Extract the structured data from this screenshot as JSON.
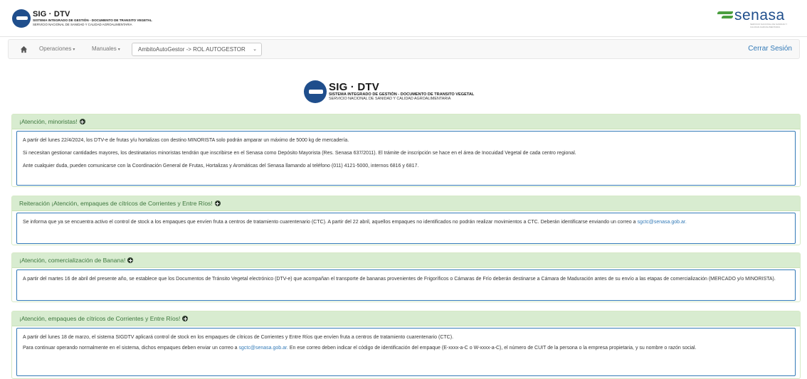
{
  "header": {
    "logo": {
      "title": "SIG · DTV",
      "line1": "SISTEMA INTEGRADO DE GESTIÓN - DOCUMENTO DE TRANSITO VEGETAL",
      "line2": "SERVICIO NACIONAL DE SANIDAD Y CALIDAD AGROALIMENTARIA"
    },
    "brand": {
      "name": "senasa",
      "tagline": "SERVICIO NACIONAL DE SANIDAD Y CALIDAD AGROALIMENTARIA",
      "color": "#1f4e8c",
      "mark_color": "#4a9e3f"
    }
  },
  "navbar": {
    "home_icon": "home-icon",
    "menu_operaciones": "Operaciones",
    "menu_manuales": "Manuales",
    "role_selected": "AmbitoAutoGestor -> ROL AUTOGESTOR",
    "logout": "Cerrar Sesión"
  },
  "center_logo": {
    "title": "SIG · DTV",
    "line1": "SISTEMA INTEGRADO DE GESTIÓN - DOCUMENTO DE TRANSITO VEGETAL",
    "line2": "SERVICIO NACIONAL DE SANIDAD Y CALIDAD AGROALIMENTARIA"
  },
  "panels": [
    {
      "title": "¡Atención, minoristas!",
      "paragraphs": [
        "A partir del lunes 22/4/2024, los DTV-e de frutas y/u hortalizas con destino MINORISTA solo podrán amparar un máximo de 5000 kg de mercadería.",
        "Si necesitan gestionar cantidades mayores, los destinatarios minoristas tendrán que inscribirse en el Senasa como Depósito Mayorista (Res. Senasa 637/2011). El trámite de inscripción se hace en el área de Inocuidad Vegetal de cada centro regional.",
        "Ante cualquier duda, pueden comunicarse con la Coordinación General de Frutas, Hortalizas y Aromáticas del Senasa llamando al teléfono (011) 4121-5000, internos 6816 y 6817."
      ]
    },
    {
      "title": "Reiteración ¡Atención, empaques de cítricos de Corrientes y Entre Ríos!",
      "text": "Se informa que ya se encuentra activo el control de stock a los empaques que envíen fruta a centros de tratamiento cuarentenario (CTC).  A partir del 22 abril, aquellos empaques no identificados no podrán realizar movimientos a CTC. Deberán identificarse enviando un correo a",
      "email": "sgctc@senasa.gob.ar."
    },
    {
      "title": "¡Atención, comercialización de Banana!",
      "text": "A partir del martes 16 de abril del presente año, se establece que los Documentos de Tránsito Vegetal electrónico (DTV-e) que acompañan el transporte de bananas provenientes de Frigoríficos o Cámaras de Frío deberán destinarse a Cámara de Maduración antes de su envío a las etapas de comercialización (MERCADO y/o MINORISTA)."
    },
    {
      "title": "¡Atención, empaques de cítricos de Corrientes y Entre Ríos!",
      "paragraph1": "A partir del lunes 18 de marzo, el sistema SIGDTV aplicará control de stock en los empaques de cítricos de Corrientes y Entre Ríos que envíen fruta a centros de tratamiento cuarentenario (CTC).",
      "paragraph2_before": "Para continuar operando normalmente en el sistema, dichos empaques deben enviar un correo a",
      "email": "sgctc@senasa.gob.ar.",
      "paragraph2_after": "En ese correo deben indicar el código de identificación del empaque (E-xxxx-a-C o W-xxxx-a-C), el número de CUIT de la persona o la empresa propietaria, y su nombre o razón social."
    }
  ]
}
